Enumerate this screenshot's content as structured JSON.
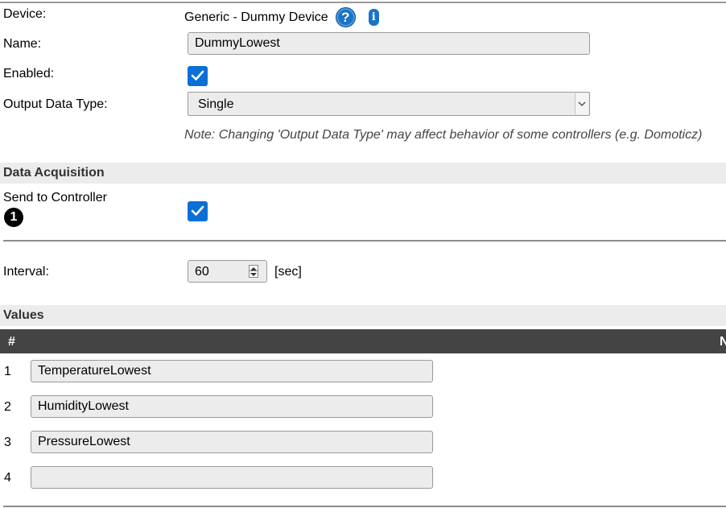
{
  "device": {
    "label": "Device:",
    "value": "Generic - Dummy Device",
    "help_icon": "?",
    "info_icon": "i"
  },
  "name": {
    "label": "Name:",
    "value": "DummyLowest"
  },
  "enabled": {
    "label": "Enabled:",
    "checked": true
  },
  "output_data_type": {
    "label": "Output Data Type:",
    "value": "Single",
    "note": "Note: Changing 'Output Data Type' may affect behavior of some controllers (e.g. Domoticz)"
  },
  "data_acquisition": {
    "title": "Data Acquisition",
    "send_to_controller": {
      "label": "Send to Controller",
      "badge": "1",
      "checked": true
    }
  },
  "interval": {
    "label": "Interval:",
    "value": "60",
    "unit": "[sec]"
  },
  "values": {
    "title": "Values",
    "header_num": "#",
    "header_name": "N",
    "rows": [
      {
        "num": "1",
        "value": "TemperatureLowest"
      },
      {
        "num": "2",
        "value": "HumidityLowest"
      },
      {
        "num": "3",
        "value": "PressureLowest"
      },
      {
        "num": "4",
        "value": ""
      }
    ]
  },
  "colors": {
    "checkbox": "#0b6fd6",
    "table_header": "#444444",
    "section_bg": "#ececec",
    "icon_blue": "#1a73c7"
  }
}
